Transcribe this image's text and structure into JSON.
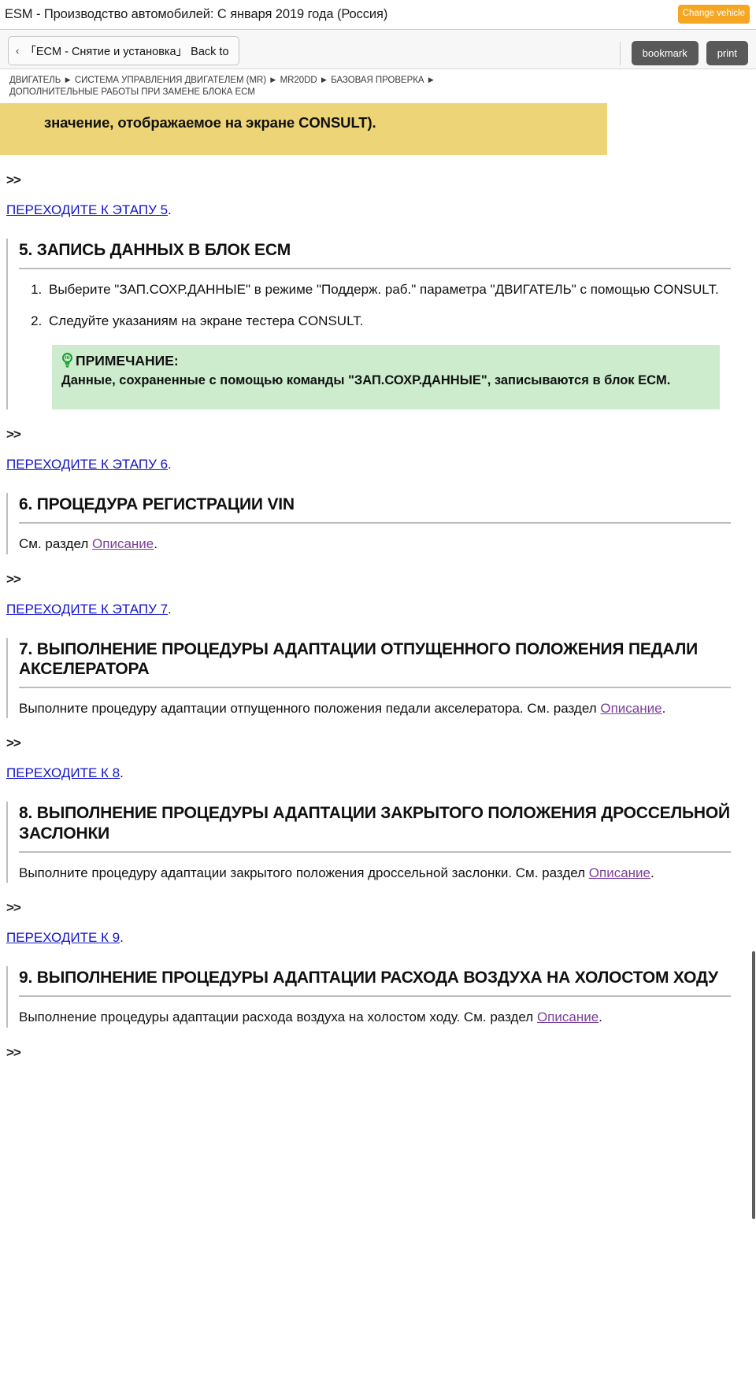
{
  "titlebar": {
    "title": "ESM - Производство автомобилей: С января 2019 года (Россия)",
    "change_vehicle_label": "Change vehicle"
  },
  "toolbar": {
    "back_chevron": "‹",
    "back_label": "「ECM - Снятие и установка」 Back to",
    "bookmark_label": "bookmark",
    "print_label": "print"
  },
  "breadcrumb": {
    "line1": "ДВИГАТЕЛЬ ► СИСТЕМА УПРАВЛЕНИЯ ДВИГАТЕЛЕМ (MR) ► MR20DD ► БАЗОВАЯ ПРОВЕРКА ►",
    "line2": "ДОПОЛНИТЕЛЬНЫЕ РАБОТЫ ПРИ ЗАМЕНЕ БЛОКА ECM"
  },
  "content": {
    "caution_text": "значение, отображаемое на экране CONSULT).",
    "arrow_mark": ">>",
    "goto5": {
      "link": "ПЕРЕХОДИТЕ К ЭТАПУ 5",
      "tail": "."
    },
    "goto6": {
      "link": "ПЕРЕХОДИТЕ К ЭТАПУ 6",
      "tail": "."
    },
    "goto7": {
      "link": "ПЕРЕХОДИТЕ К ЭТАПУ 7",
      "tail": "."
    },
    "goto8": {
      "link": "ПЕРЕХОДИТЕ К 8",
      "tail": "."
    },
    "goto9": {
      "link": "ПЕРЕХОДИТЕ К 9",
      "tail": "."
    },
    "section5": {
      "title": "5. ЗАПИСЬ ДАННЫХ В БЛОК ECM",
      "steps": [
        "Выберите \"ЗАП.СОХР.ДАННЫЕ\" в режиме \"Поддерж. раб.\" параметра \"ДВИГАТЕЛЬ\" с помощью CONSULT.",
        "Следуйте указаниям на экране тестера CONSULT."
      ],
      "note": {
        "icon": "lightbulb-icon",
        "heading": "ПРИМЕЧАНИЕ:",
        "text": "Данные, сохраненные с помощью команды \"ЗАП.СОХР.ДАННЫЕ\", записываются в блок ECM."
      }
    },
    "section6": {
      "title": "6. ПРОЦЕДУРА РЕГИСТРАЦИИ VIN",
      "body_prefix": "См. раздел ",
      "body_link": "Описание",
      "body_suffix": "."
    },
    "section7": {
      "title": "7. ВЫПОЛНЕНИЕ ПРОЦЕДУРЫ АДАПТАЦИИ ОТПУЩЕННОГО ПОЛОЖЕНИЯ ПЕДАЛИ АКСЕЛЕРАТОРА",
      "body_prefix": "Выполните процедуру адаптации отпущенного положения педали акселератора. См. раздел ",
      "body_link": "Описание",
      "body_suffix": "."
    },
    "section8": {
      "title": "8. ВЫПОЛНЕНИЕ ПРОЦЕДУРЫ АДАПТАЦИИ ЗАКРЫТОГО ПОЛОЖЕНИЯ ДРОССЕЛЬНОЙ ЗАСЛОНКИ",
      "body_prefix": "Выполните процедуру адаптации закрытого положения дроссельной заслонки. См. раздел ",
      "body_link": "Описание",
      "body_suffix": "."
    },
    "section9": {
      "title": "9. ВЫПОЛНЕНИЕ ПРОЦЕДУРЫ АДАПТАЦИИ РАСХОДА ВОЗДУХА НА ХОЛОСТОМ ХОДУ",
      "body_prefix": "Выполнение процедуры адаптации расхода воздуха на холостом ходу. См. раздел ",
      "body_link": "Описание",
      "body_suffix": "."
    }
  },
  "colors": {
    "accent_orange": "#f5a623",
    "caution_yellow": "#ecd477",
    "note_green": "#cceccd",
    "link_blue": "#1414c8",
    "link_visited_purple": "#7b3f98",
    "toolbar_dark": "#595959"
  }
}
